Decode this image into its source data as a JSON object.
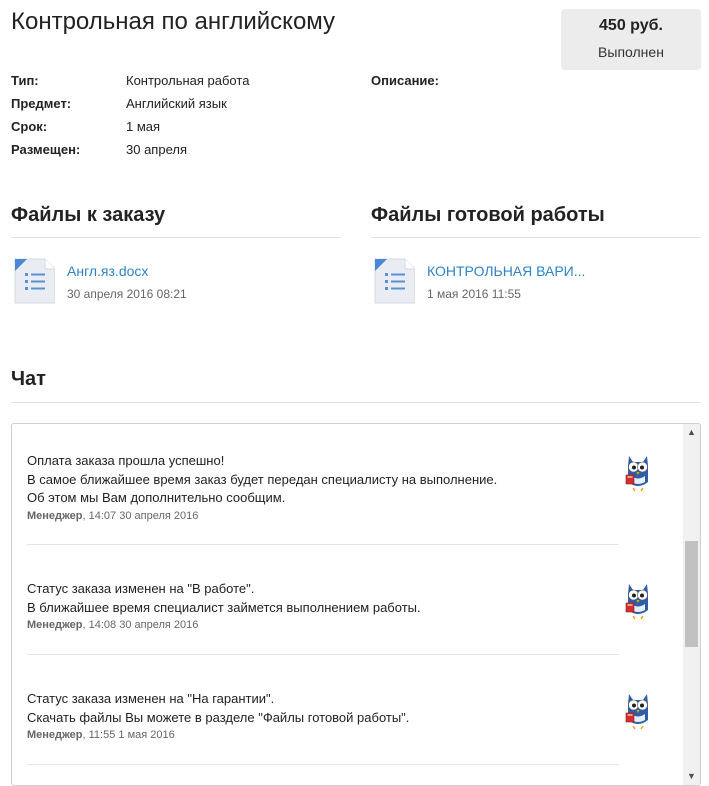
{
  "order": {
    "title": "Контрольная по английскому",
    "price": "450 руб.",
    "status": "Выполнен"
  },
  "info": {
    "type_label": "Тип:",
    "type_value": "Контрольная работа",
    "subject_label": "Предмет:",
    "subject_value": "Английский язык",
    "deadline_label": "Срок:",
    "deadline_value": "1 мая",
    "posted_label": "Размещен:",
    "posted_value": "30 апреля",
    "description_label": "Описание:"
  },
  "order_files": {
    "title": "Файлы к заказу",
    "items": [
      {
        "name": "Англ.яз.docx",
        "date": "30 апреля 2016 08:21",
        "icon": "document-icon"
      }
    ]
  },
  "result_files": {
    "title": "Файлы готовой работы",
    "items": [
      {
        "name": "КОНТРОЛЬНАЯ ВАРИ...",
        "date": "1 мая 2016 11:55",
        "icon": "document-icon"
      }
    ]
  },
  "chat": {
    "title": "Чат",
    "messages": [
      {
        "lines": [
          "Оплата заказа прошла успешно!",
          "В самое ближайшее время заказ будет передан специалисту на выполнение.",
          "Об этом мы Вам дополнительно сообщим."
        ],
        "author": "Менеджер",
        "time": ", 14:07 30 апреля 2016",
        "avatar": "owl-icon"
      },
      {
        "lines": [
          "Статус заказа изменен на \"В работе\".",
          "В ближайшее время специалист займется выполнением работы."
        ],
        "author": "Менеджер",
        "time": ", 14:08 30 апреля 2016",
        "avatar": "owl-icon"
      },
      {
        "lines": [
          "Статус заказа изменен на \"На гарантии\".",
          "Скачать файлы Вы можете в разделе \"Файлы готовой работы\"."
        ],
        "author": "Менеджер",
        "time": ", 11:55 1 мая 2016",
        "avatar": "owl-icon"
      }
    ]
  },
  "colors": {
    "link": "#2f83c6",
    "price_box_bg": "#ececec"
  }
}
